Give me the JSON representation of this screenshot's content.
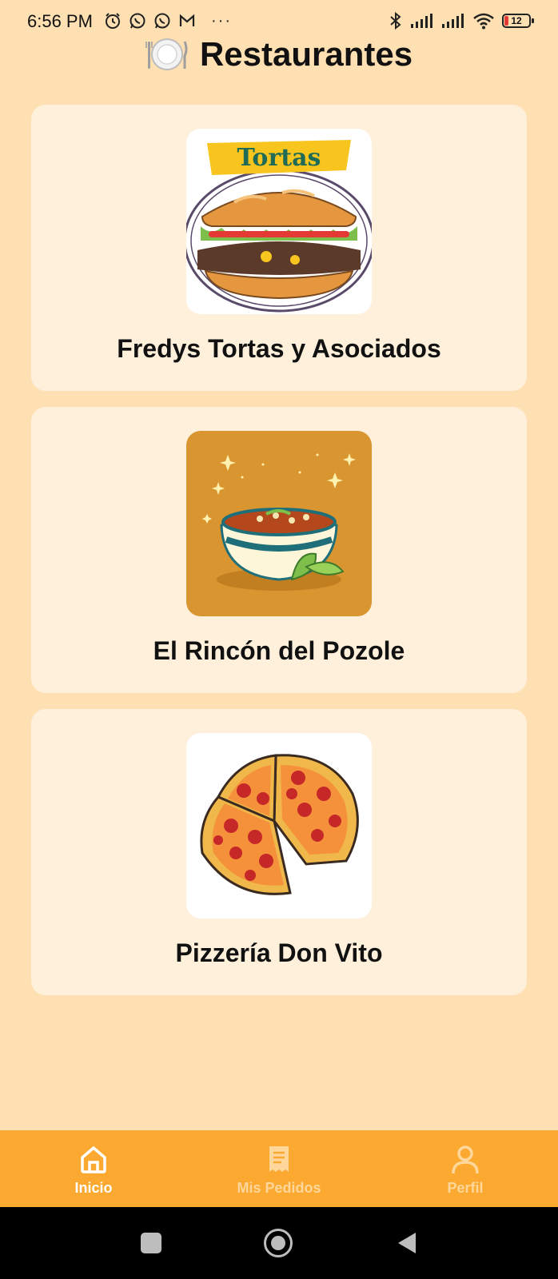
{
  "status_bar": {
    "time": "6:56 PM",
    "left_icons": [
      "alarm-icon",
      "whatsapp-icon",
      "whatsapp-business-icon",
      "gmail-icon",
      "more-dots-icon"
    ],
    "more": "···",
    "right_icons": [
      "bluetooth-icon",
      "signal-icon",
      "signal-icon",
      "wifi-icon",
      "battery-icon"
    ],
    "battery_level": "12"
  },
  "header": {
    "icon": "plate-utensils-icon",
    "title": "Restaurantes"
  },
  "restaurants": [
    {
      "name": "Fredys Tortas y Asociados",
      "image": "torta-sandwich-image",
      "image_text": "Tortas"
    },
    {
      "name": "El Rincón del Pozole",
      "image": "pozole-bowl-image"
    },
    {
      "name": "Pizzería Don Vito",
      "image": "pepperoni-pizza-image"
    }
  ],
  "bottom_nav": {
    "items": [
      {
        "label": "Inicio",
        "icon": "home-icon",
        "active": true
      },
      {
        "label": "Mis Pedidos",
        "icon": "orders-receipt-icon",
        "active": false
      },
      {
        "label": "Perfil",
        "icon": "person-icon",
        "active": false
      }
    ]
  },
  "colors": {
    "background": "#FFE0B2",
    "card": "#FFF0DC",
    "nav_bar": "#FBA930",
    "nav_active": "#FFFFFF",
    "nav_inactive": "#FFD79A"
  }
}
